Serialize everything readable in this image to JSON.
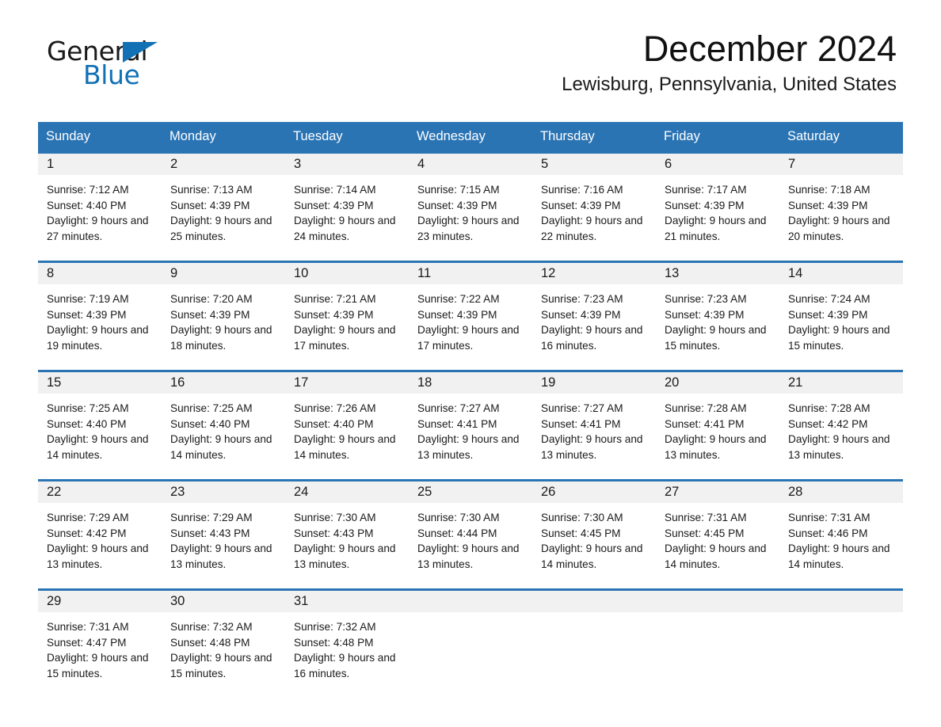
{
  "brand": {
    "name_top": "General",
    "name_bottom": "Blue",
    "accent_color": "#1271b5"
  },
  "header": {
    "title": "December 2024",
    "location": "Lewisburg, Pennsylvania, United States"
  },
  "calendar": {
    "header_bg": "#2a74b4",
    "daynum_bg": "#f1f1f1",
    "weekdays": [
      "Sunday",
      "Monday",
      "Tuesday",
      "Wednesday",
      "Thursday",
      "Friday",
      "Saturday"
    ],
    "weeks": [
      [
        {
          "day": "1",
          "sunrise": "Sunrise: 7:12 AM",
          "sunset": "Sunset: 4:40 PM",
          "daylight": "Daylight: 9 hours and 27 minutes."
        },
        {
          "day": "2",
          "sunrise": "Sunrise: 7:13 AM",
          "sunset": "Sunset: 4:39 PM",
          "daylight": "Daylight: 9 hours and 25 minutes."
        },
        {
          "day": "3",
          "sunrise": "Sunrise: 7:14 AM",
          "sunset": "Sunset: 4:39 PM",
          "daylight": "Daylight: 9 hours and 24 minutes."
        },
        {
          "day": "4",
          "sunrise": "Sunrise: 7:15 AM",
          "sunset": "Sunset: 4:39 PM",
          "daylight": "Daylight: 9 hours and 23 minutes."
        },
        {
          "day": "5",
          "sunrise": "Sunrise: 7:16 AM",
          "sunset": "Sunset: 4:39 PM",
          "daylight": "Daylight: 9 hours and 22 minutes."
        },
        {
          "day": "6",
          "sunrise": "Sunrise: 7:17 AM",
          "sunset": "Sunset: 4:39 PM",
          "daylight": "Daylight: 9 hours and 21 minutes."
        },
        {
          "day": "7",
          "sunrise": "Sunrise: 7:18 AM",
          "sunset": "Sunset: 4:39 PM",
          "daylight": "Daylight: 9 hours and 20 minutes."
        }
      ],
      [
        {
          "day": "8",
          "sunrise": "Sunrise: 7:19 AM",
          "sunset": "Sunset: 4:39 PM",
          "daylight": "Daylight: 9 hours and 19 minutes."
        },
        {
          "day": "9",
          "sunrise": "Sunrise: 7:20 AM",
          "sunset": "Sunset: 4:39 PM",
          "daylight": "Daylight: 9 hours and 18 minutes."
        },
        {
          "day": "10",
          "sunrise": "Sunrise: 7:21 AM",
          "sunset": "Sunset: 4:39 PM",
          "daylight": "Daylight: 9 hours and 17 minutes."
        },
        {
          "day": "11",
          "sunrise": "Sunrise: 7:22 AM",
          "sunset": "Sunset: 4:39 PM",
          "daylight": "Daylight: 9 hours and 17 minutes."
        },
        {
          "day": "12",
          "sunrise": "Sunrise: 7:23 AM",
          "sunset": "Sunset: 4:39 PM",
          "daylight": "Daylight: 9 hours and 16 minutes."
        },
        {
          "day": "13",
          "sunrise": "Sunrise: 7:23 AM",
          "sunset": "Sunset: 4:39 PM",
          "daylight": "Daylight: 9 hours and 15 minutes."
        },
        {
          "day": "14",
          "sunrise": "Sunrise: 7:24 AM",
          "sunset": "Sunset: 4:39 PM",
          "daylight": "Daylight: 9 hours and 15 minutes."
        }
      ],
      [
        {
          "day": "15",
          "sunrise": "Sunrise: 7:25 AM",
          "sunset": "Sunset: 4:40 PM",
          "daylight": "Daylight: 9 hours and 14 minutes."
        },
        {
          "day": "16",
          "sunrise": "Sunrise: 7:25 AM",
          "sunset": "Sunset: 4:40 PM",
          "daylight": "Daylight: 9 hours and 14 minutes."
        },
        {
          "day": "17",
          "sunrise": "Sunrise: 7:26 AM",
          "sunset": "Sunset: 4:40 PM",
          "daylight": "Daylight: 9 hours and 14 minutes."
        },
        {
          "day": "18",
          "sunrise": "Sunrise: 7:27 AM",
          "sunset": "Sunset: 4:41 PM",
          "daylight": "Daylight: 9 hours and 13 minutes."
        },
        {
          "day": "19",
          "sunrise": "Sunrise: 7:27 AM",
          "sunset": "Sunset: 4:41 PM",
          "daylight": "Daylight: 9 hours and 13 minutes."
        },
        {
          "day": "20",
          "sunrise": "Sunrise: 7:28 AM",
          "sunset": "Sunset: 4:41 PM",
          "daylight": "Daylight: 9 hours and 13 minutes."
        },
        {
          "day": "21",
          "sunrise": "Sunrise: 7:28 AM",
          "sunset": "Sunset: 4:42 PM",
          "daylight": "Daylight: 9 hours and 13 minutes."
        }
      ],
      [
        {
          "day": "22",
          "sunrise": "Sunrise: 7:29 AM",
          "sunset": "Sunset: 4:42 PM",
          "daylight": "Daylight: 9 hours and 13 minutes."
        },
        {
          "day": "23",
          "sunrise": "Sunrise: 7:29 AM",
          "sunset": "Sunset: 4:43 PM",
          "daylight": "Daylight: 9 hours and 13 minutes."
        },
        {
          "day": "24",
          "sunrise": "Sunrise: 7:30 AM",
          "sunset": "Sunset: 4:43 PM",
          "daylight": "Daylight: 9 hours and 13 minutes."
        },
        {
          "day": "25",
          "sunrise": "Sunrise: 7:30 AM",
          "sunset": "Sunset: 4:44 PM",
          "daylight": "Daylight: 9 hours and 13 minutes."
        },
        {
          "day": "26",
          "sunrise": "Sunrise: 7:30 AM",
          "sunset": "Sunset: 4:45 PM",
          "daylight": "Daylight: 9 hours and 14 minutes."
        },
        {
          "day": "27",
          "sunrise": "Sunrise: 7:31 AM",
          "sunset": "Sunset: 4:45 PM",
          "daylight": "Daylight: 9 hours and 14 minutes."
        },
        {
          "day": "28",
          "sunrise": "Sunrise: 7:31 AM",
          "sunset": "Sunset: 4:46 PM",
          "daylight": "Daylight: 9 hours and 14 minutes."
        }
      ],
      [
        {
          "day": "29",
          "sunrise": "Sunrise: 7:31 AM",
          "sunset": "Sunset: 4:47 PM",
          "daylight": "Daylight: 9 hours and 15 minutes."
        },
        {
          "day": "30",
          "sunrise": "Sunrise: 7:32 AM",
          "sunset": "Sunset: 4:48 PM",
          "daylight": "Daylight: 9 hours and 15 minutes."
        },
        {
          "day": "31",
          "sunrise": "Sunrise: 7:32 AM",
          "sunset": "Sunset: 4:48 PM",
          "daylight": "Daylight: 9 hours and 16 minutes."
        },
        {
          "day": "",
          "sunrise": "",
          "sunset": "",
          "daylight": ""
        },
        {
          "day": "",
          "sunrise": "",
          "sunset": "",
          "daylight": ""
        },
        {
          "day": "",
          "sunrise": "",
          "sunset": "",
          "daylight": ""
        },
        {
          "day": "",
          "sunrise": "",
          "sunset": "",
          "daylight": ""
        }
      ]
    ]
  }
}
